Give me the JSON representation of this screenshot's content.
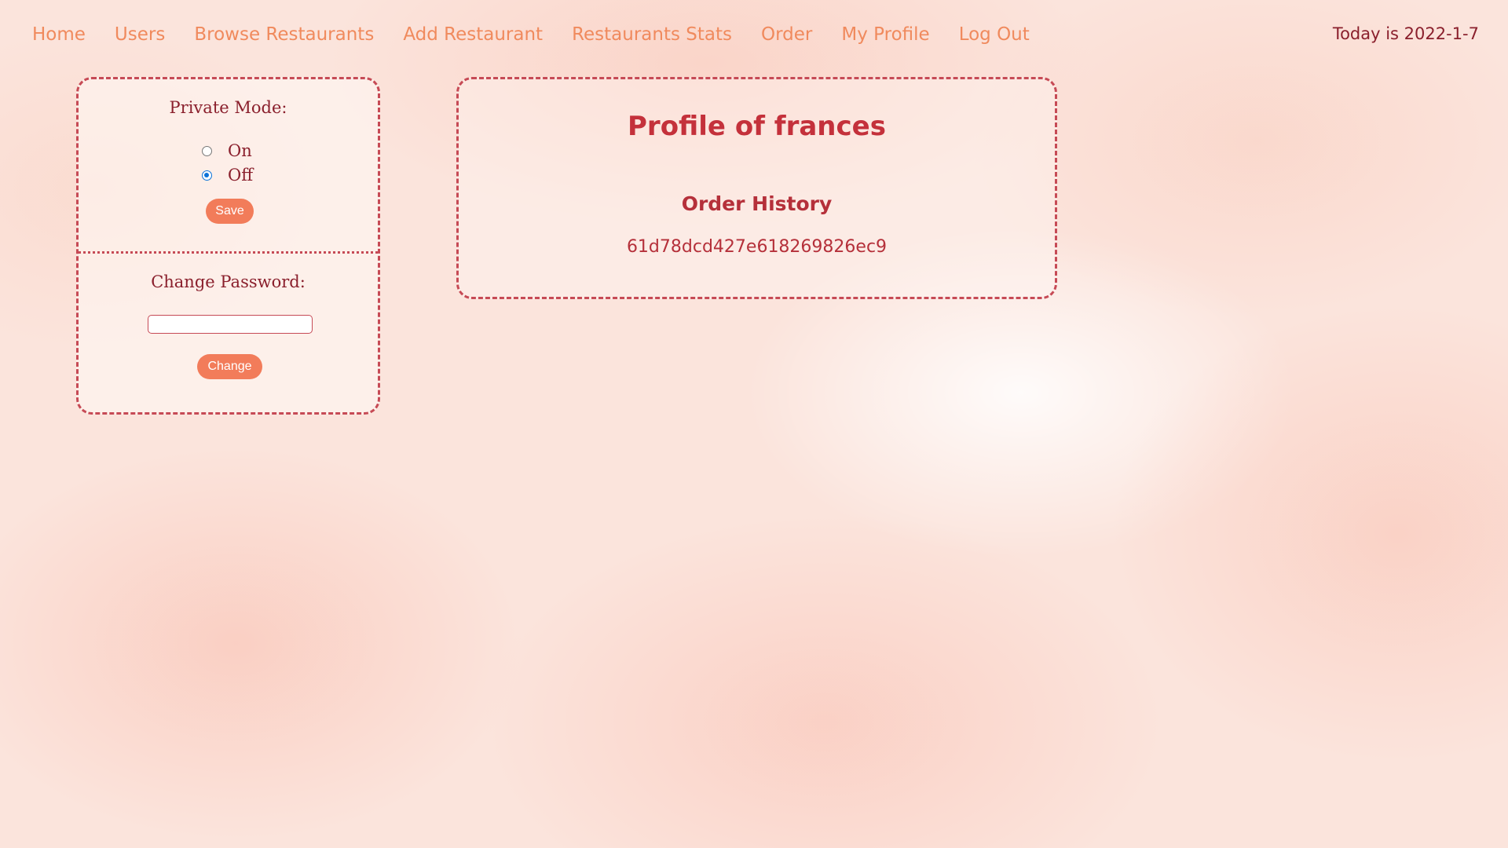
{
  "nav": {
    "links": [
      {
        "label": "Home"
      },
      {
        "label": "Users"
      },
      {
        "label": "Browse Restaurants"
      },
      {
        "label": "Add Restaurant"
      },
      {
        "label": "Restaurants Stats"
      },
      {
        "label": "Order"
      },
      {
        "label": "My Profile"
      },
      {
        "label": "Log Out"
      }
    ],
    "today": "Today is 2022-1-7"
  },
  "settings": {
    "private_mode": {
      "label": "Private Mode:",
      "options": [
        {
          "label": "On",
          "checked": false
        },
        {
          "label": "Off",
          "checked": true
        }
      ],
      "save_label": "Save"
    },
    "change_password": {
      "label": "Change Password:",
      "input_value": "",
      "change_label": "Change"
    }
  },
  "profile": {
    "title": "Profile of frances",
    "order_history_label": "Order History",
    "orders": [
      "61d78dcd427e618269826ec9"
    ]
  },
  "colors": {
    "nav_link": "#f08a5d",
    "accent_button": "#f27c5a",
    "border": "#c64a55",
    "title": "#c4313b",
    "today_text": "#8a1f2c"
  }
}
